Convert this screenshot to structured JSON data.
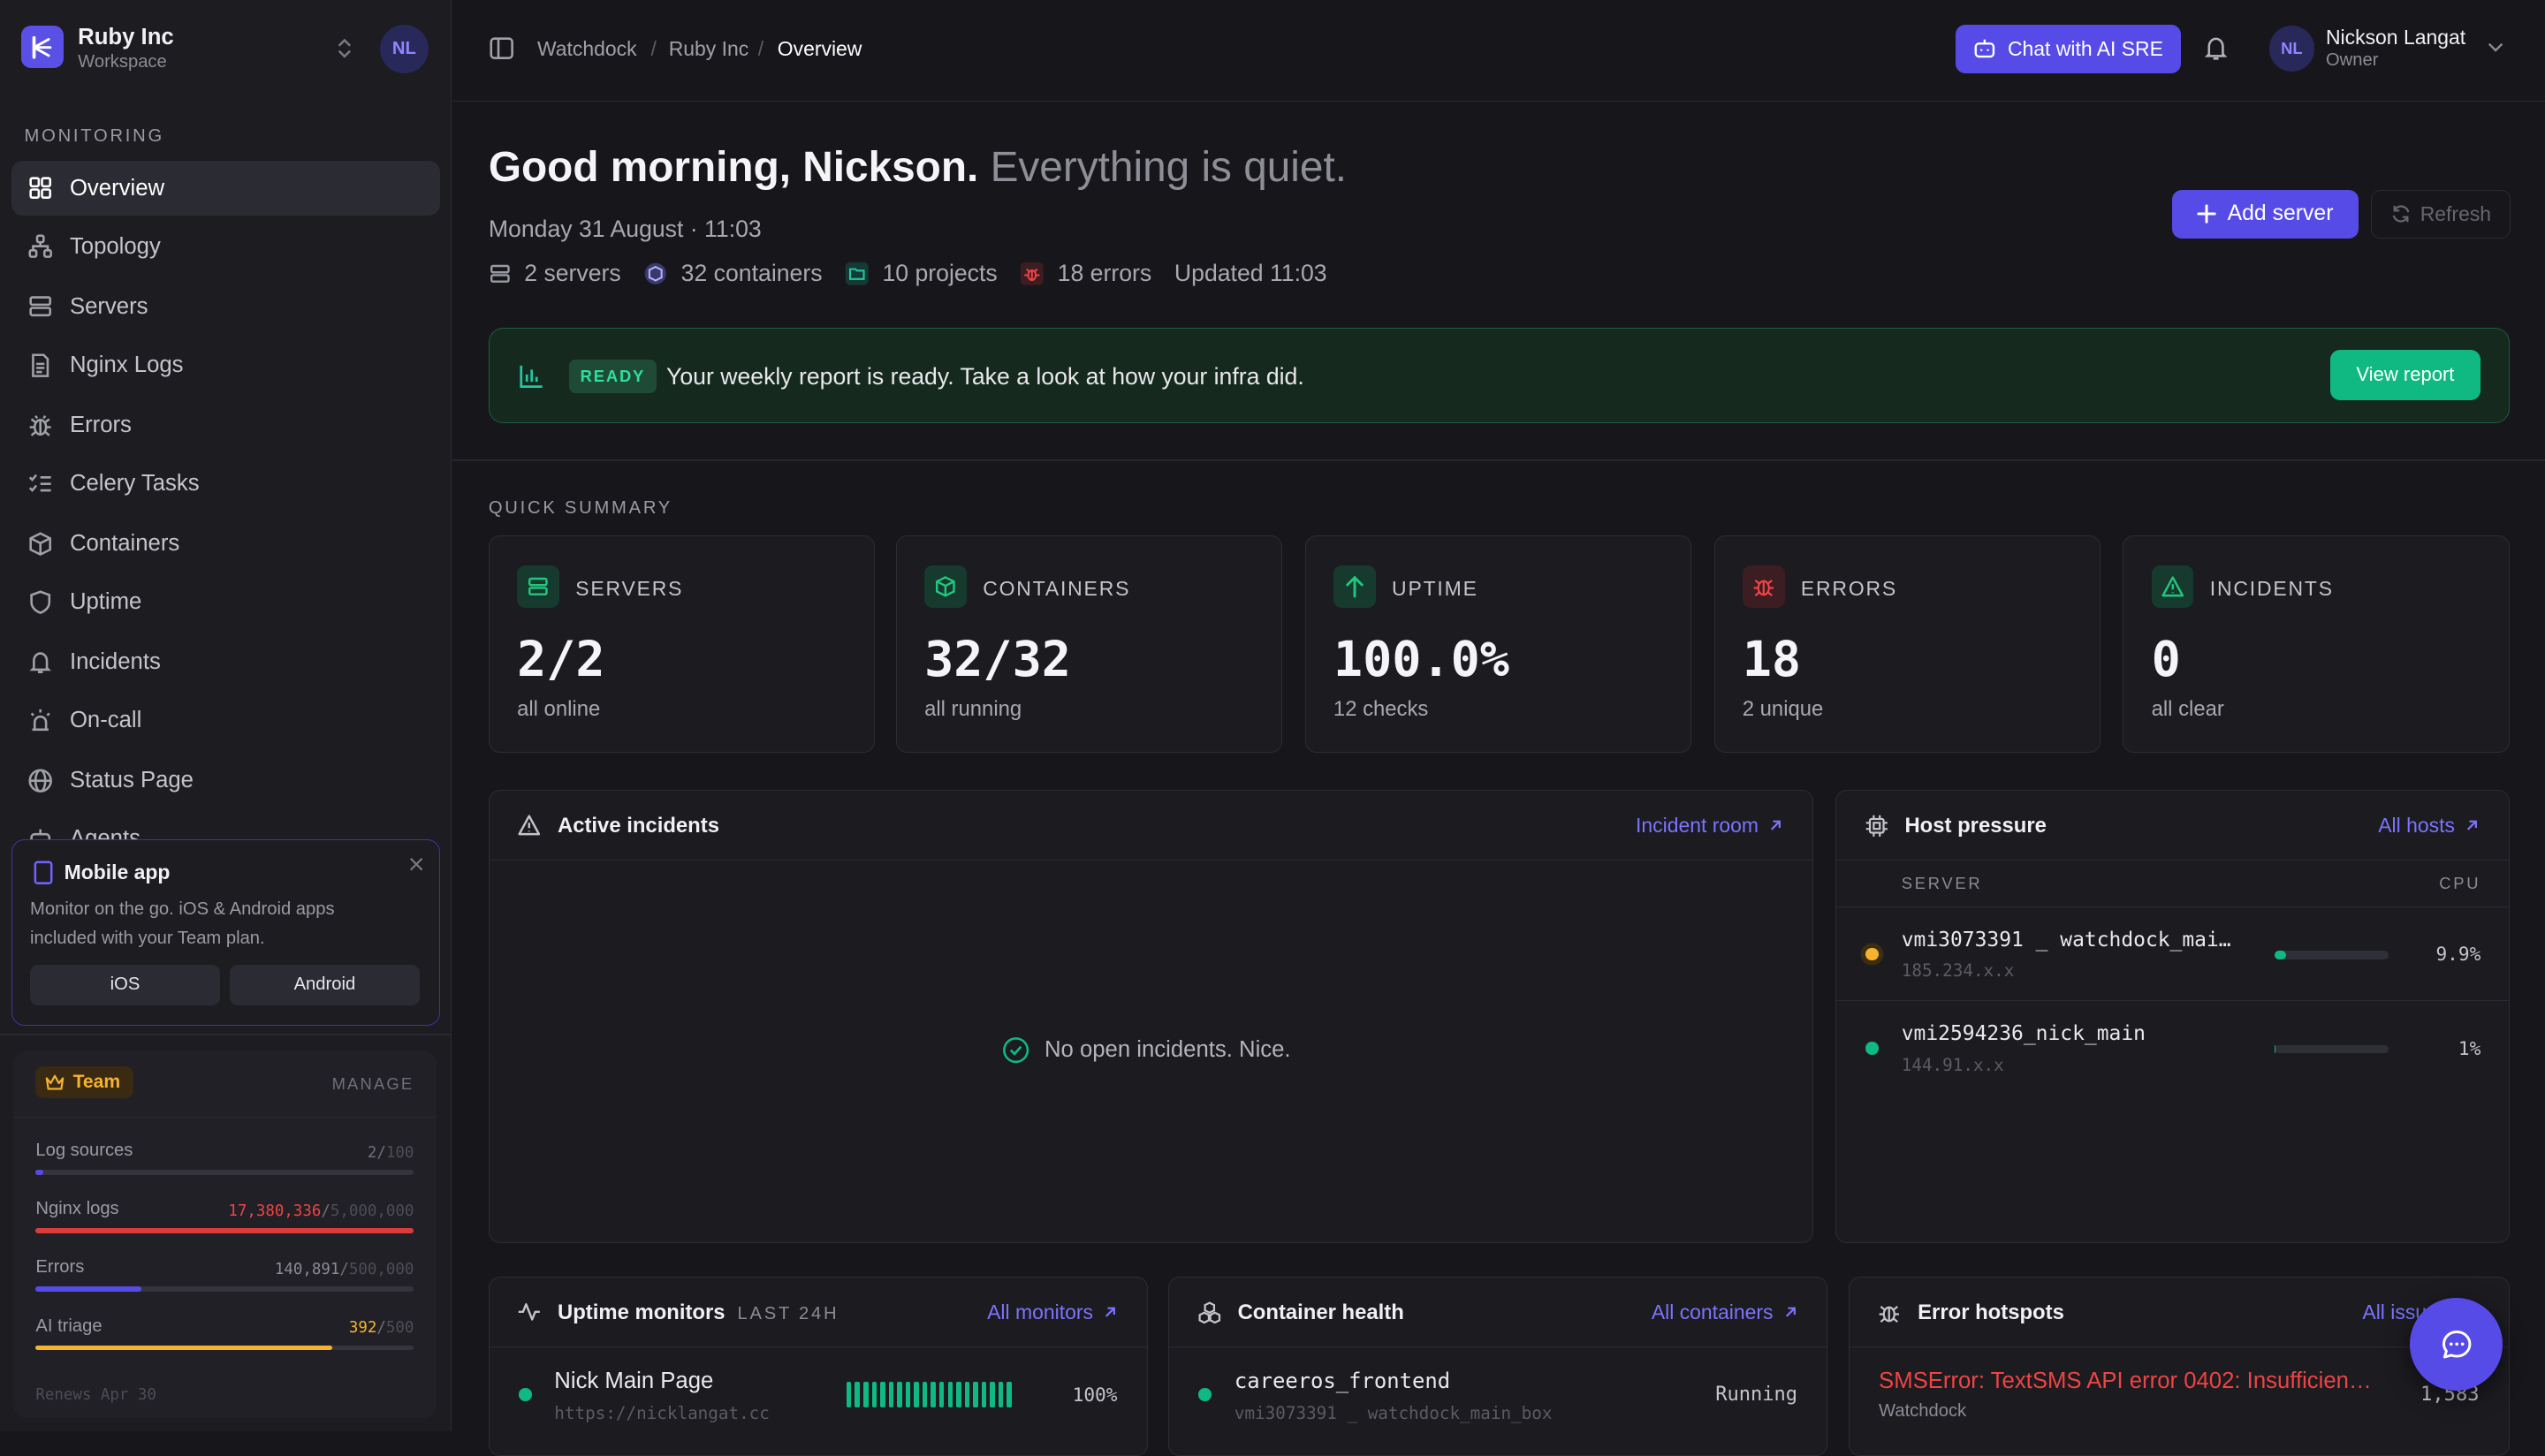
{
  "workspace": {
    "name": "Ruby Inc",
    "subtitle": "Workspace",
    "avatar": "NL"
  },
  "sidebar": {
    "section_label": "MONITORING",
    "items": [
      {
        "label": "Overview",
        "icon": "grid-icon",
        "active": true
      },
      {
        "label": "Topology",
        "icon": "topology-icon"
      },
      {
        "label": "Servers",
        "icon": "server-icon"
      },
      {
        "label": "Nginx Logs",
        "icon": "file-text-icon"
      },
      {
        "label": "Errors",
        "icon": "bug-icon"
      },
      {
        "label": "Celery Tasks",
        "icon": "list-checks-icon"
      },
      {
        "label": "Containers",
        "icon": "box-icon"
      },
      {
        "label": "Uptime",
        "icon": "shield-icon"
      },
      {
        "label": "Incidents",
        "icon": "bell-icon"
      },
      {
        "label": "On-call",
        "icon": "siren-icon"
      },
      {
        "label": "Status Page",
        "icon": "globe-icon"
      },
      {
        "label": "Agents",
        "icon": "bot-icon"
      }
    ]
  },
  "mobile_app": {
    "title": "Mobile app",
    "description": "Monitor on the go. iOS & Android apps included with your Team plan.",
    "ios_label": "iOS",
    "android_label": "Android"
  },
  "team": {
    "badge": "Team",
    "manage_label": "MANAGE",
    "usage": [
      {
        "label": "Log sources",
        "used": "2",
        "limit": "100",
        "fraction": 0.02,
        "color": "#574be8",
        "used_color": "#6f6f78"
      },
      {
        "label": "Nginx logs",
        "used": "17,380,336",
        "limit": "5,000,000",
        "fraction": 1.0,
        "color": "#dc3b3b",
        "used_color": "#ef4444"
      },
      {
        "label": "Errors",
        "used": "140,891",
        "limit": "500,000",
        "fraction": 0.28,
        "color": "#574be8",
        "used_color": "#8b8b94"
      },
      {
        "label": "AI triage",
        "used": "392",
        "limit": "500",
        "fraction": 0.784,
        "color": "#f5b32e",
        "used_color": "#f5b32e"
      }
    ],
    "renews": "Renews Apr 30"
  },
  "header": {
    "breadcrumb": [
      "Watchdock",
      "Ruby Inc",
      "Overview"
    ],
    "chat_label": "Chat with AI SRE",
    "user_name": "Nickson Langat",
    "user_role": "Owner",
    "user_avatar": "NL"
  },
  "greeting": {
    "main": "Good morning, Nickson.",
    "sub": "Everything is quiet.",
    "date": "Monday 31 August · 11:03",
    "stats": {
      "servers": "2 servers",
      "containers": "32 containers",
      "projects": "10 projects",
      "errors": "18 errors",
      "updated": "Updated 11:03"
    },
    "add_server_label": "Add server",
    "refresh_label": "Refresh"
  },
  "report": {
    "badge": "READY",
    "text": "Your weekly report is ready. Take a look at how your infra did.",
    "button": "View report"
  },
  "quick_summary": {
    "label": "QUICK SUMMARY",
    "cards": [
      {
        "title": "SERVERS",
        "value": "2/2",
        "sub": "all online",
        "icon": "server-icon"
      },
      {
        "title": "CONTAINERS",
        "value": "32/32",
        "sub": "all running",
        "icon": "box-icon"
      },
      {
        "title": "UPTIME",
        "value": "100.0%",
        "sub": "12 checks",
        "icon": "arrow-up-icon"
      },
      {
        "title": "ERRORS",
        "value": "18",
        "sub": "2 unique",
        "icon": "bug-icon"
      },
      {
        "title": "INCIDENTS",
        "value": "0",
        "sub": "all clear",
        "icon": "alert-triangle-icon"
      }
    ]
  },
  "active_incidents": {
    "title": "Active incidents",
    "link": "Incident room",
    "empty": "No open incidents. Nice."
  },
  "host_pressure": {
    "title": "Host pressure",
    "link": "All hosts",
    "col_server": "SERVER",
    "col_cpu": "CPU",
    "hosts": [
      {
        "name": "vmi3073391 _ watchdock_mai…",
        "ip": "185.234.x.x",
        "cpu": "9.9%",
        "cpu_fraction": 0.099,
        "status_color": "#f5b32e"
      },
      {
        "name": "vmi2594236_nick_main",
        "ip": "144.91.x.x",
        "cpu": "1%",
        "cpu_fraction": 0.01,
        "status_color": "#10b981"
      }
    ]
  },
  "uptime_monitors": {
    "title": "Uptime monitors",
    "period": "LAST 24H",
    "link": "All monitors",
    "rows": [
      {
        "name": "Nick Main Page",
        "url": "https://nicklangat.cc",
        "pct": "100%",
        "uptime_fraction": 1.0
      }
    ]
  },
  "container_health": {
    "title": "Container health",
    "link": "All containers",
    "rows": [
      {
        "name": "careeros_frontend",
        "host": "vmi3073391 _ watchdock_main_box",
        "status": "Running"
      }
    ]
  },
  "error_hotspots": {
    "title": "Error hotspots",
    "link": "All issues",
    "rows": [
      {
        "message": "SMSError: TextSMS API error 0402: Insufficien…",
        "project": "Watchdock",
        "count": "1,583"
      }
    ]
  }
}
